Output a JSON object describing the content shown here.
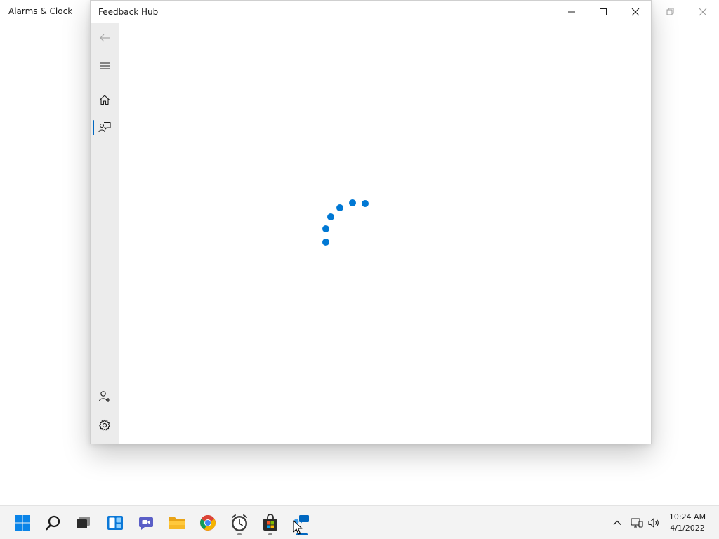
{
  "background_app": {
    "title": "Alarms & Clock"
  },
  "window": {
    "title": "Feedback Hub",
    "controls": {
      "minimize": "minimize-icon",
      "maximize": "maximize-icon",
      "close": "close-icon"
    },
    "nav": {
      "items": [
        {
          "id": "back",
          "icon": "back-arrow-icon",
          "enabled": false
        },
        {
          "id": "menu",
          "icon": "hamburger-menu-icon"
        },
        {
          "id": "home",
          "icon": "home-icon"
        },
        {
          "id": "feedback",
          "icon": "feedback-icon",
          "selected": true
        },
        {
          "id": "account",
          "icon": "add-user-icon"
        },
        {
          "id": "settings",
          "icon": "gear-icon"
        }
      ]
    },
    "content": {
      "state": "loading",
      "spinner": "progress-ring-icon",
      "accent": "#0078d4"
    }
  },
  "taskbar": {
    "apps": [
      {
        "name": "Start",
        "icon": "windows-start-icon"
      },
      {
        "name": "Search",
        "icon": "search-icon"
      },
      {
        "name": "Task View",
        "icon": "task-view-icon"
      },
      {
        "name": "Widgets",
        "icon": "widgets-icon"
      },
      {
        "name": "Chat",
        "icon": "teams-chat-icon"
      },
      {
        "name": "File Explorer",
        "icon": "folder-icon"
      },
      {
        "name": "Google Chrome",
        "icon": "chrome-icon"
      },
      {
        "name": "Alarms & Clock",
        "icon": "alarm-clock-icon",
        "running": true
      },
      {
        "name": "Microsoft Store",
        "icon": "store-icon",
        "running": true
      },
      {
        "name": "Feedback Hub",
        "icon": "feedback-hub-icon",
        "running": true,
        "active": true
      }
    ],
    "tray": {
      "icons": [
        "chevron-up-icon",
        "network-icon",
        "volume-icon"
      ],
      "time": "10:24 AM",
      "date": "4/1/2022"
    }
  }
}
